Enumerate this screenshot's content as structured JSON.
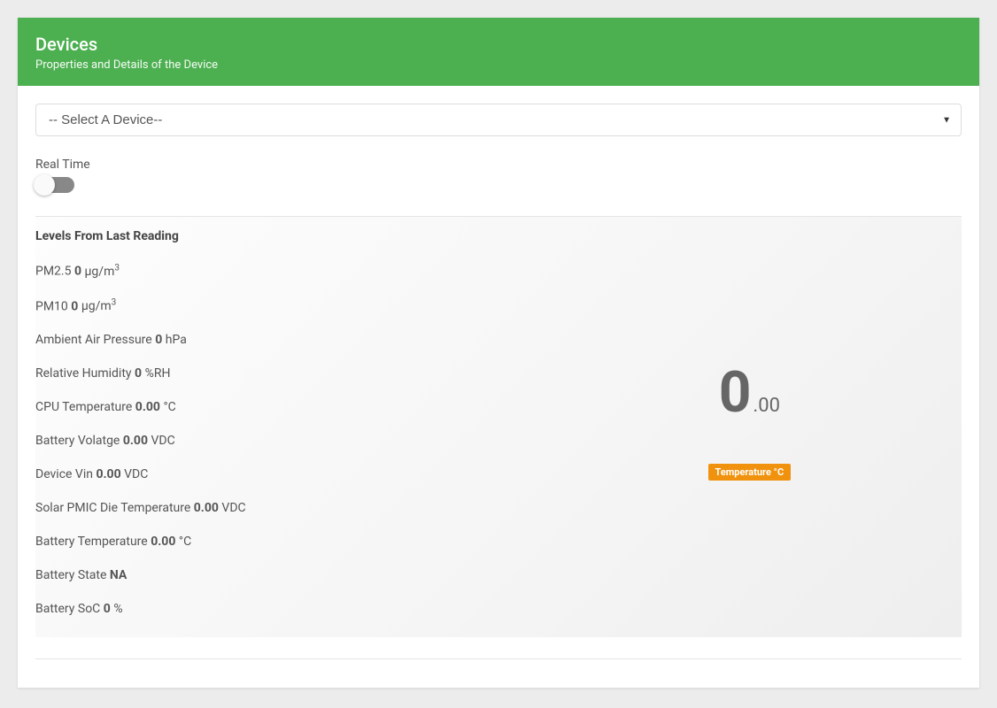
{
  "header": {
    "title": "Devices",
    "subtitle": "Properties and Details of the Device"
  },
  "deviceSelect": {
    "placeholder": "-- Select A Device--"
  },
  "realtime": {
    "label": "Real Time",
    "enabled": false
  },
  "panel": {
    "title": "Levels From Last Reading"
  },
  "readings": {
    "pm25": {
      "label": "PM2.5",
      "value": "0",
      "unit_prefix": "µg/m",
      "unit_sup": "3"
    },
    "pm10": {
      "label": "PM10",
      "value": "0",
      "unit_prefix": "µg/m",
      "unit_sup": "3"
    },
    "pressure": {
      "label": "Ambient Air Pressure",
      "value": "0",
      "unit": "hPa"
    },
    "humidity": {
      "label": "Relative Humidity",
      "value": "0",
      "unit": "%RH"
    },
    "cpu_temp": {
      "label": "CPU Temperature",
      "value": "0.00",
      "unit": "°C"
    },
    "batt_v": {
      "label": "Battery Volatge",
      "value": "0.00",
      "unit": "VDC"
    },
    "vin": {
      "label": "Device Vin",
      "value": "0.00",
      "unit": "VDC"
    },
    "solar": {
      "label": "Solar PMIC Die Temperature",
      "value": "0.00",
      "unit": "VDC"
    },
    "batt_temp": {
      "label": "Battery Temperature",
      "value": "0.00",
      "unit": "°C"
    },
    "batt_state": {
      "label": "Battery State",
      "value": "NA",
      "unit": ""
    },
    "batt_soc": {
      "label": "Battery SoC",
      "value": "0",
      "unit": "%"
    }
  },
  "bigDisplay": {
    "int": "0",
    "dec": ".00",
    "badge": "Temperature °C"
  }
}
